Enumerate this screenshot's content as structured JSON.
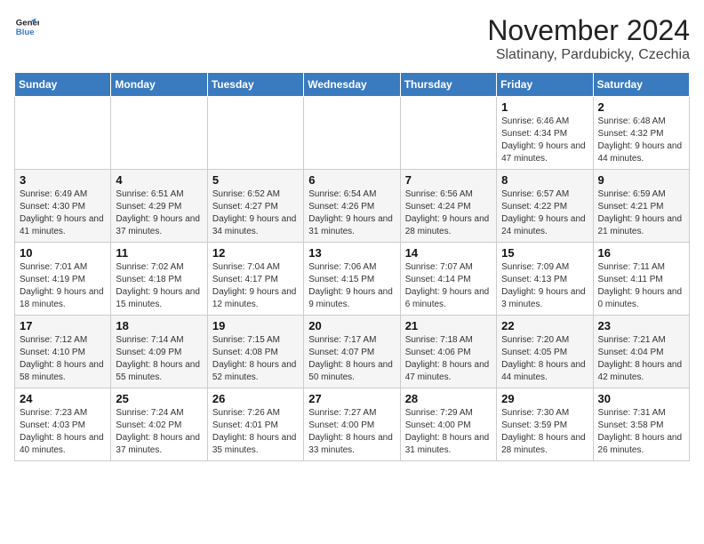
{
  "header": {
    "logo_line1": "General",
    "logo_line2": "Blue",
    "month": "November 2024",
    "location": "Slatinany, Pardubicky, Czechia"
  },
  "weekdays": [
    "Sunday",
    "Monday",
    "Tuesday",
    "Wednesday",
    "Thursday",
    "Friday",
    "Saturday"
  ],
  "weeks": [
    [
      {
        "day": "",
        "info": ""
      },
      {
        "day": "",
        "info": ""
      },
      {
        "day": "",
        "info": ""
      },
      {
        "day": "",
        "info": ""
      },
      {
        "day": "",
        "info": ""
      },
      {
        "day": "1",
        "info": "Sunrise: 6:46 AM\nSunset: 4:34 PM\nDaylight: 9 hours and 47 minutes."
      },
      {
        "day": "2",
        "info": "Sunrise: 6:48 AM\nSunset: 4:32 PM\nDaylight: 9 hours and 44 minutes."
      }
    ],
    [
      {
        "day": "3",
        "info": "Sunrise: 6:49 AM\nSunset: 4:30 PM\nDaylight: 9 hours and 41 minutes."
      },
      {
        "day": "4",
        "info": "Sunrise: 6:51 AM\nSunset: 4:29 PM\nDaylight: 9 hours and 37 minutes."
      },
      {
        "day": "5",
        "info": "Sunrise: 6:52 AM\nSunset: 4:27 PM\nDaylight: 9 hours and 34 minutes."
      },
      {
        "day": "6",
        "info": "Sunrise: 6:54 AM\nSunset: 4:26 PM\nDaylight: 9 hours and 31 minutes."
      },
      {
        "day": "7",
        "info": "Sunrise: 6:56 AM\nSunset: 4:24 PM\nDaylight: 9 hours and 28 minutes."
      },
      {
        "day": "8",
        "info": "Sunrise: 6:57 AM\nSunset: 4:22 PM\nDaylight: 9 hours and 24 minutes."
      },
      {
        "day": "9",
        "info": "Sunrise: 6:59 AM\nSunset: 4:21 PM\nDaylight: 9 hours and 21 minutes."
      }
    ],
    [
      {
        "day": "10",
        "info": "Sunrise: 7:01 AM\nSunset: 4:19 PM\nDaylight: 9 hours and 18 minutes."
      },
      {
        "day": "11",
        "info": "Sunrise: 7:02 AM\nSunset: 4:18 PM\nDaylight: 9 hours and 15 minutes."
      },
      {
        "day": "12",
        "info": "Sunrise: 7:04 AM\nSunset: 4:17 PM\nDaylight: 9 hours and 12 minutes."
      },
      {
        "day": "13",
        "info": "Sunrise: 7:06 AM\nSunset: 4:15 PM\nDaylight: 9 hours and 9 minutes."
      },
      {
        "day": "14",
        "info": "Sunrise: 7:07 AM\nSunset: 4:14 PM\nDaylight: 9 hours and 6 minutes."
      },
      {
        "day": "15",
        "info": "Sunrise: 7:09 AM\nSunset: 4:13 PM\nDaylight: 9 hours and 3 minutes."
      },
      {
        "day": "16",
        "info": "Sunrise: 7:11 AM\nSunset: 4:11 PM\nDaylight: 9 hours and 0 minutes."
      }
    ],
    [
      {
        "day": "17",
        "info": "Sunrise: 7:12 AM\nSunset: 4:10 PM\nDaylight: 8 hours and 58 minutes."
      },
      {
        "day": "18",
        "info": "Sunrise: 7:14 AM\nSunset: 4:09 PM\nDaylight: 8 hours and 55 minutes."
      },
      {
        "day": "19",
        "info": "Sunrise: 7:15 AM\nSunset: 4:08 PM\nDaylight: 8 hours and 52 minutes."
      },
      {
        "day": "20",
        "info": "Sunrise: 7:17 AM\nSunset: 4:07 PM\nDaylight: 8 hours and 50 minutes."
      },
      {
        "day": "21",
        "info": "Sunrise: 7:18 AM\nSunset: 4:06 PM\nDaylight: 8 hours and 47 minutes."
      },
      {
        "day": "22",
        "info": "Sunrise: 7:20 AM\nSunset: 4:05 PM\nDaylight: 8 hours and 44 minutes."
      },
      {
        "day": "23",
        "info": "Sunrise: 7:21 AM\nSunset: 4:04 PM\nDaylight: 8 hours and 42 minutes."
      }
    ],
    [
      {
        "day": "24",
        "info": "Sunrise: 7:23 AM\nSunset: 4:03 PM\nDaylight: 8 hours and 40 minutes."
      },
      {
        "day": "25",
        "info": "Sunrise: 7:24 AM\nSunset: 4:02 PM\nDaylight: 8 hours and 37 minutes."
      },
      {
        "day": "26",
        "info": "Sunrise: 7:26 AM\nSunset: 4:01 PM\nDaylight: 8 hours and 35 minutes."
      },
      {
        "day": "27",
        "info": "Sunrise: 7:27 AM\nSunset: 4:00 PM\nDaylight: 8 hours and 33 minutes."
      },
      {
        "day": "28",
        "info": "Sunrise: 7:29 AM\nSunset: 4:00 PM\nDaylight: 8 hours and 31 minutes."
      },
      {
        "day": "29",
        "info": "Sunrise: 7:30 AM\nSunset: 3:59 PM\nDaylight: 8 hours and 28 minutes."
      },
      {
        "day": "30",
        "info": "Sunrise: 7:31 AM\nSunset: 3:58 PM\nDaylight: 8 hours and 26 minutes."
      }
    ]
  ]
}
